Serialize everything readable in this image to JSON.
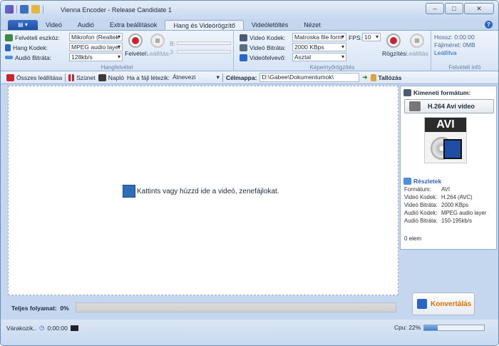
{
  "window": {
    "title": "Vienna Encoder - Release Candidate 1"
  },
  "menu_tabs": [
    "Videó",
    "Audió",
    "Extra beállítások",
    "Hang és Videórögzítő",
    "Videóletöltés",
    "Nézet"
  ],
  "audio_group": {
    "label": "Hangfelvétel",
    "device_label": "Felvételi eszköz:",
    "device_value": "Mikrofon (Realtek",
    "codec_label": "Hang Kodek:",
    "codec_value": "MPEG audio layer",
    "bitrate_label": "Audió Bitráta:",
    "bitrate_value": "128kb/s",
    "record_label": "Felvétel",
    "stop_label": "Leállítás",
    "b_label": "B:",
    "j_label": "J:"
  },
  "screen_group": {
    "label": "Képernyőrögzítés",
    "codec_label": "Videó Kodek:",
    "codec_value": "Matroska file form",
    "bitrate_label": "Videó Bitráta:",
    "bitrate_value": "2000 KBps",
    "recorder_label": "Videófelvevő:",
    "recorder_value": "Asztal",
    "fps_label": "FPS:",
    "fps_value": "10",
    "record_label": "Rögzítés",
    "stop_label": "Leállítás"
  },
  "rec_info": {
    "label": "Felvételi infó",
    "length": "Hossz: 0:00:00",
    "size": "Fájlméret: 0MB",
    "state": "Leállítva"
  },
  "toolbar": {
    "stop_all": "Összes leállítása",
    "pause": "Szünet",
    "log": "Napló",
    "if_exists_label": "Ha a fájl létezik:",
    "if_exists_value": "Átnevezi",
    "dest_label": "Célmappa:",
    "dest_value": "D:\\Gabee\\Dokumentumok\\",
    "browse": "Tallózás"
  },
  "drop_text": "Kattints vagy húzzd ide a videó, zenefájlokat.",
  "output": {
    "title": "Kimeneti formátum:",
    "format_button": "H.264 Avi video",
    "badge": "AVI",
    "details_title": "Részletek",
    "details": [
      {
        "k": "Formátum:",
        "v": "AVI"
      },
      {
        "k": "Videó Kodek:",
        "v": "H.264 (AVC)"
      },
      {
        "k": "Videó Bitráta:",
        "v": "2000 KBps"
      },
      {
        "k": "Audió Kodek:",
        "v": "MPEG audio layer"
      },
      {
        "k": "Audió Bitráta:",
        "v": "150-195kb/s"
      }
    ],
    "items": "0 elem"
  },
  "progress": {
    "label": "Teljes folyamat:",
    "value": "0%"
  },
  "convert_button": "Konvertálás",
  "status": {
    "state": "Várakozik..",
    "time": "0:00:00",
    "cpu_label": "Cpu: 22%",
    "cpu_fraction": 0.22
  }
}
